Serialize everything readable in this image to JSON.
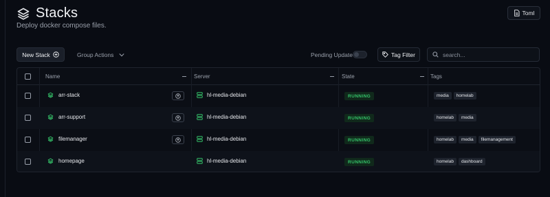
{
  "header": {
    "title": "Stacks",
    "subtitle": "Deploy docker compose files.",
    "toml_label": "Toml"
  },
  "toolbar": {
    "new_stack_label": "New Stack",
    "group_actions_label": "Group Actions",
    "pending_update_label": "Pending Update",
    "pending_update_enabled": false,
    "tag_filter_label": "Tag Filter",
    "search_placeholder": "search..."
  },
  "table": {
    "columns": [
      "Name",
      "Server",
      "State",
      "Tags"
    ],
    "rows": [
      {
        "name": "arr-stack",
        "server": "hl-media-debian",
        "state": "RUNNING",
        "tags": [
          "media",
          "homelab"
        ],
        "has_action": true
      },
      {
        "name": "arr-support",
        "server": "hl-media-debian",
        "state": "RUNNING",
        "tags": [
          "homelab",
          "media"
        ],
        "has_action": true
      },
      {
        "name": "filemanager",
        "server": "hl-media-debian",
        "state": "RUNNING",
        "tags": [
          "homelab",
          "media",
          "filemanagement"
        ],
        "has_action": true
      },
      {
        "name": "homepage",
        "server": "hl-media-debian",
        "state": "RUNNING",
        "tags": [
          "homelab",
          "dashboard"
        ],
        "has_action": false
      }
    ]
  },
  "colors": {
    "background": "#090c13",
    "running_text": "#35c46a",
    "running_bg": "#10291b",
    "stack_icon": "#35c46a"
  }
}
